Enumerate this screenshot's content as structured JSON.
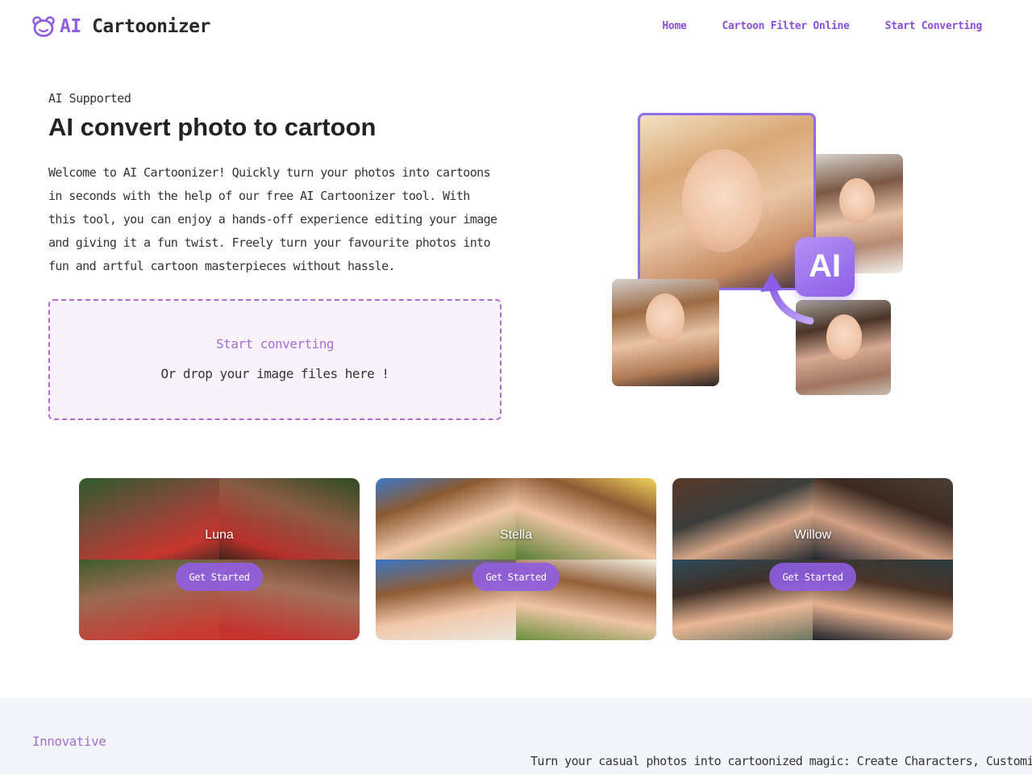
{
  "header": {
    "logo_ai": "AI",
    "logo_name": "Cartoonizer",
    "nav": [
      "Home",
      "Cartoon Filter Online",
      "Start Converting"
    ]
  },
  "hero": {
    "eyebrow": "AI Supported",
    "title": "AI convert photo to cartoon",
    "description": "Welcome to AI Cartoonizer! Quickly turn your photos into cartoons in seconds with the help of our free AI Cartoonizer tool. With this tool, you can enjoy a hands-off experience editing your image and giving it a fun twist. Freely turn your favourite photos into fun and artful cartoon masterpieces without hassle.",
    "badge_text": "AI"
  },
  "dropzone": {
    "title": "Start converting",
    "subtitle": "Or drop your image files here !"
  },
  "styles": [
    {
      "name": "Luna",
      "button": "Get Started"
    },
    {
      "name": "Stella",
      "button": "Get Started"
    },
    {
      "name": "Willow",
      "button": "Get Started"
    }
  ],
  "bottom": {
    "eyebrow": "Innovative",
    "text": "Turn your casual photos into cartoonized magic: Create Characters, Customize"
  },
  "colors": {
    "accent": "#8f5fe0",
    "nav_link": "#8a4fd6",
    "dropzone_border": "#b36ad1",
    "dropzone_bg": "#f8f3fb",
    "bottom_bg": "#f2f5fa"
  }
}
